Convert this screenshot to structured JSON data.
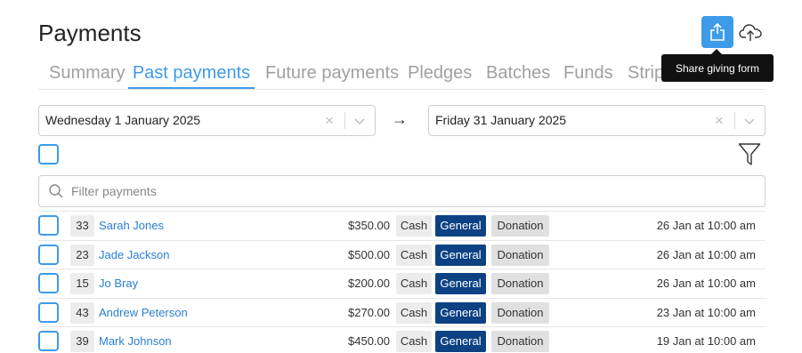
{
  "header": {
    "title": "Payments",
    "tooltip": "Share giving form",
    "share_icon": "share-icon",
    "upload_icon": "cloud-upload-icon"
  },
  "tabs": [
    {
      "label": "Summary",
      "active": false
    },
    {
      "label": "Past payments",
      "active": true
    },
    {
      "label": "Future payments",
      "active": false
    },
    {
      "label": "Pledges",
      "active": false
    },
    {
      "label": "Batches",
      "active": false
    },
    {
      "label": "Funds",
      "active": false
    },
    {
      "label": "Stripe",
      "active": false
    }
  ],
  "date_range": {
    "from": "Wednesday 1 January 2025",
    "arrow": "→",
    "to": "Friday 31 January 2025",
    "clear_symbol": "×"
  },
  "filter": {
    "placeholder": "Filter payments"
  },
  "payments": [
    {
      "num": "33",
      "name": "Sarah Jones",
      "amount": "$350.00",
      "method": "Cash",
      "fund": "General",
      "type": "Donation",
      "date": "26 Jan at 10:00 am"
    },
    {
      "num": "23",
      "name": "Jade Jackson",
      "amount": "$500.00",
      "method": "Cash",
      "fund": "General",
      "type": "Donation",
      "date": "26 Jan at 10:00 am"
    },
    {
      "num": "15",
      "name": "Jo Bray",
      "amount": "$200.00",
      "method": "Cash",
      "fund": "General",
      "type": "Donation",
      "date": "26 Jan at 10:00 am"
    },
    {
      "num": "43",
      "name": "Andrew Peterson",
      "amount": "$270.00",
      "method": "Cash",
      "fund": "General",
      "type": "Donation",
      "date": "23 Jan at 10:00 am"
    },
    {
      "num": "39",
      "name": "Mark Johnson",
      "amount": "$450.00",
      "method": "Cash",
      "fund": "General",
      "type": "Donation",
      "date": "19 Jan at 10:00 am"
    }
  ],
  "colors": {
    "accent": "#3d9be9",
    "fund_badge": "#0c4283",
    "link": "#2a7fd0"
  }
}
